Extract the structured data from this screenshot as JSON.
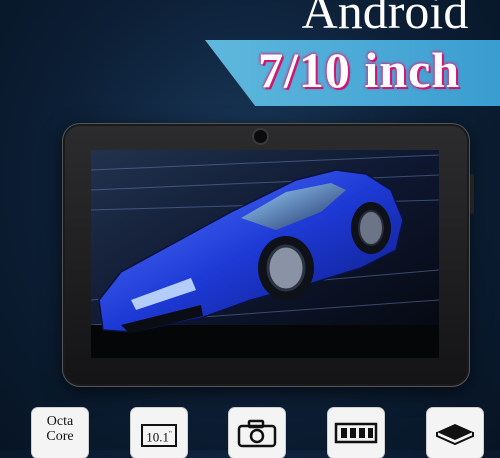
{
  "banner": {
    "headline": "Android",
    "ribbon_text": "7/10 inch",
    "accent_color": "#3a9dd0",
    "ribbon_text_glow": "#e3197a"
  },
  "device": {
    "screen_image": "blue sports car"
  },
  "features": [
    {
      "icon": "text-badge",
      "line1": "Octa",
      "line2": "Core"
    },
    {
      "icon": "screen-size-icon",
      "value": "10.1",
      "unit": "\""
    },
    {
      "icon": "camera-icon"
    },
    {
      "icon": "memory-card-icon"
    },
    {
      "icon": "storage-drive-icon"
    }
  ]
}
